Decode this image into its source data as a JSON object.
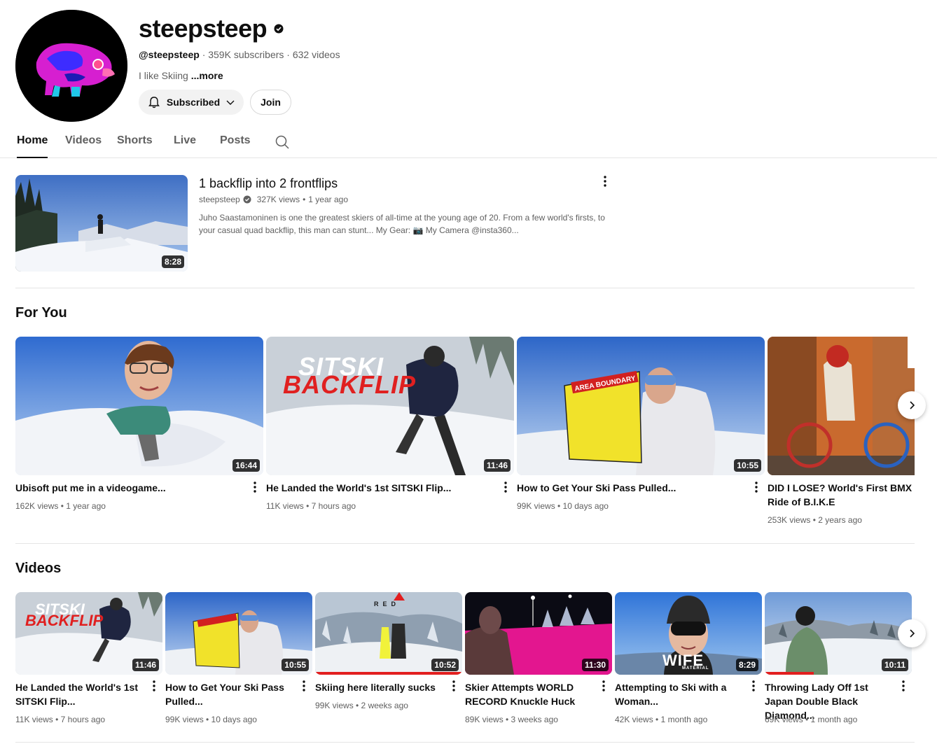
{
  "channel": {
    "name": "steepsteep",
    "handle": "@steepsteep",
    "subscribers": "· 359K subscribers",
    "videos_count": "· 632 videos",
    "description": "I like Skiing",
    "more_label": "...more",
    "subscribed_label": "Subscribed",
    "join_label": "Join"
  },
  "tabs": [
    {
      "label": "Home"
    },
    {
      "label": "Videos"
    },
    {
      "label": "Shorts"
    },
    {
      "label": "Live"
    },
    {
      "label": "Posts"
    }
  ],
  "featured": {
    "title": "1 backflip into 2 frontflips",
    "channel": "steepsteep",
    "views": "327K views",
    "age": "1 year ago",
    "description": "Juho Saastamoninen is one the greatest skiers of all-time at the young age of 20. From a few world's firsts, to your casual quad backflip, this man can stunt... My Gear: 📷 My Camera @insta360...",
    "duration": "8:28"
  },
  "for_you": {
    "title": "For You",
    "items": [
      {
        "title": "Ubisoft put me in a videogame...",
        "meta": "162K views • 1 year ago",
        "duration": "16:44"
      },
      {
        "title": "He Landed the World's 1st SITSKI Flip...",
        "meta": "11K views • 7 hours ago",
        "duration": "11:46",
        "overlay1": "SITSKI",
        "overlay2": "BACKFLIP"
      },
      {
        "title": "How to Get Your Ski Pass Pulled...",
        "meta": "99K views • 10 days ago",
        "duration": "10:55",
        "sign": "AREA BOUNDARY"
      },
      {
        "title": "DID I LOSE? World's First BMX Ride of B.I.K.E",
        "meta": "253K views • 2 years ago"
      }
    ]
  },
  "videos": {
    "title": "Videos",
    "items": [
      {
        "title": "He Landed the World's 1st SITSKI Flip...",
        "meta": "11K views • 7 hours ago",
        "duration": "11:46",
        "overlay1": "SITSKI",
        "overlay2": "BACKFLIP"
      },
      {
        "title": "How to Get Your Ski Pass Pulled...",
        "meta": "99K views • 10 days ago",
        "duration": "10:55",
        "sign": "AREA BOUNDARY"
      },
      {
        "title": "Skiing here literally sucks",
        "meta": "99K views • 2 weeks ago",
        "duration": "10:52",
        "logo": "RED"
      },
      {
        "title": "Skier Attempts WORLD RECORD Knuckle Huck",
        "meta": "89K views • 3 weeks ago",
        "duration": "11:30"
      },
      {
        "title": "Attempting to Ski with a Woman...",
        "meta": "42K views • 1 month ago",
        "duration": "8:29",
        "overlay": "WIFE",
        "overlay_sub": "MATERIAL"
      },
      {
        "title": "Throwing Lady Off 1st Japan Double Black Diamond...",
        "meta": "69K views • 1 month ago",
        "duration": "10:11"
      }
    ]
  },
  "colors": {
    "accent": "#0f0f0f",
    "muted": "#606060",
    "chip": "#f2f2f2"
  }
}
